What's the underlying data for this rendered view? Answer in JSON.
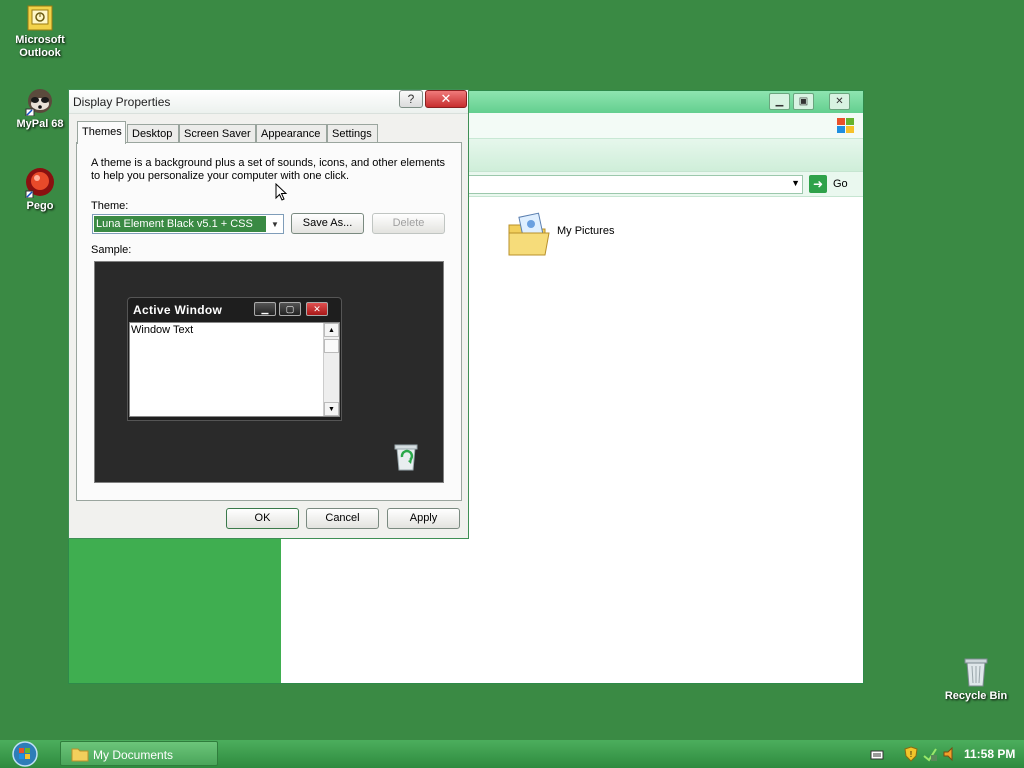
{
  "desktop": {
    "icons": [
      {
        "label_line1": "Microsoft",
        "label_line2": "Outlook"
      },
      {
        "label_line1": "MyPal 68"
      },
      {
        "label_line1": "Pego"
      },
      {
        "label_line1": "Recycle Bin"
      }
    ]
  },
  "explorer": {
    "go_label": "Go",
    "items": [
      {
        "label": "My Pictures"
      }
    ]
  },
  "dialog": {
    "title": "Display Properties",
    "help_glyph": "?",
    "close_glyph": "✕",
    "tabs": [
      "Themes",
      "Desktop",
      "Screen Saver",
      "Appearance",
      "Settings"
    ],
    "active_tab": "Themes",
    "description": "A theme is a background plus a set of sounds, icons, and other elements to help you personalize your computer with one click.",
    "theme_label": "Theme:",
    "theme_value": "Luna Element Black v5.1 + CSS",
    "save_as_label": "Save As...",
    "delete_label": "Delete",
    "sample_label": "Sample:",
    "sample": {
      "window_title": "Active Window",
      "window_text": "Window Text"
    },
    "ok_label": "OK",
    "cancel_label": "Cancel",
    "apply_label": "Apply"
  },
  "taskbar": {
    "task_label": "My Documents",
    "clock": "11:58 PM"
  },
  "colors": {
    "desktop": "#3a8a44",
    "selection": "#3a8a44",
    "taskbar": "#2e8a3e"
  }
}
